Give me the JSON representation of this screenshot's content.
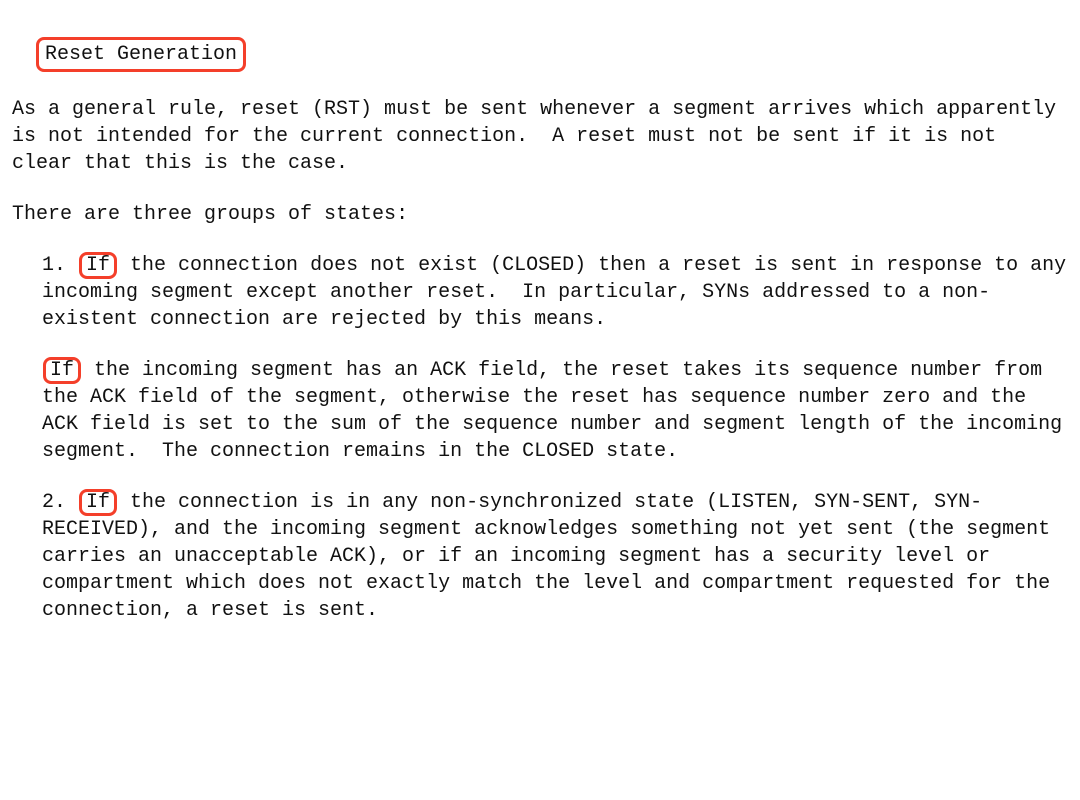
{
  "heading": "Reset Generation",
  "intro": {
    "p1": "As a general rule, reset (RST) must be sent whenever a segment arrives which apparently is not intended for the current connection.  A reset must not be sent if it is not clear that this is the case.",
    "p2": "There are three groups of states:"
  },
  "items": [
    {
      "marker": "  1.  ",
      "lead_word": "If",
      "lead_rest": " the connection does not exist (CLOSED) then a reset is sent in response to any incoming segment except another reset.  In particular, SYNs addressed to a non-existent connection are rejected by this means.",
      "sub": {
        "lead_word": "If",
        "lead_rest": " the incoming segment has an ACK field, the reset takes its sequence number from the ACK field of the segment, otherwise the reset has sequence number zero and the ACK field is set to the sum of the sequence number and segment length of the incoming segment.  The connection remains in the CLOSED state."
      }
    },
    {
      "marker": "  2.  ",
      "lead_word": "If",
      "lead_rest": " the connection is in any non-synchronized state (LISTEN, SYN-SENT, SYN-RECEIVED), and the incoming segment acknowledges something not yet sent (the segment carries an unacceptable ACK), or if an incoming segment has a security level or compartment which does not exactly match the level and compartment requested for the connection, a reset is sent."
    }
  ],
  "highlight_color": "#f43f2a"
}
